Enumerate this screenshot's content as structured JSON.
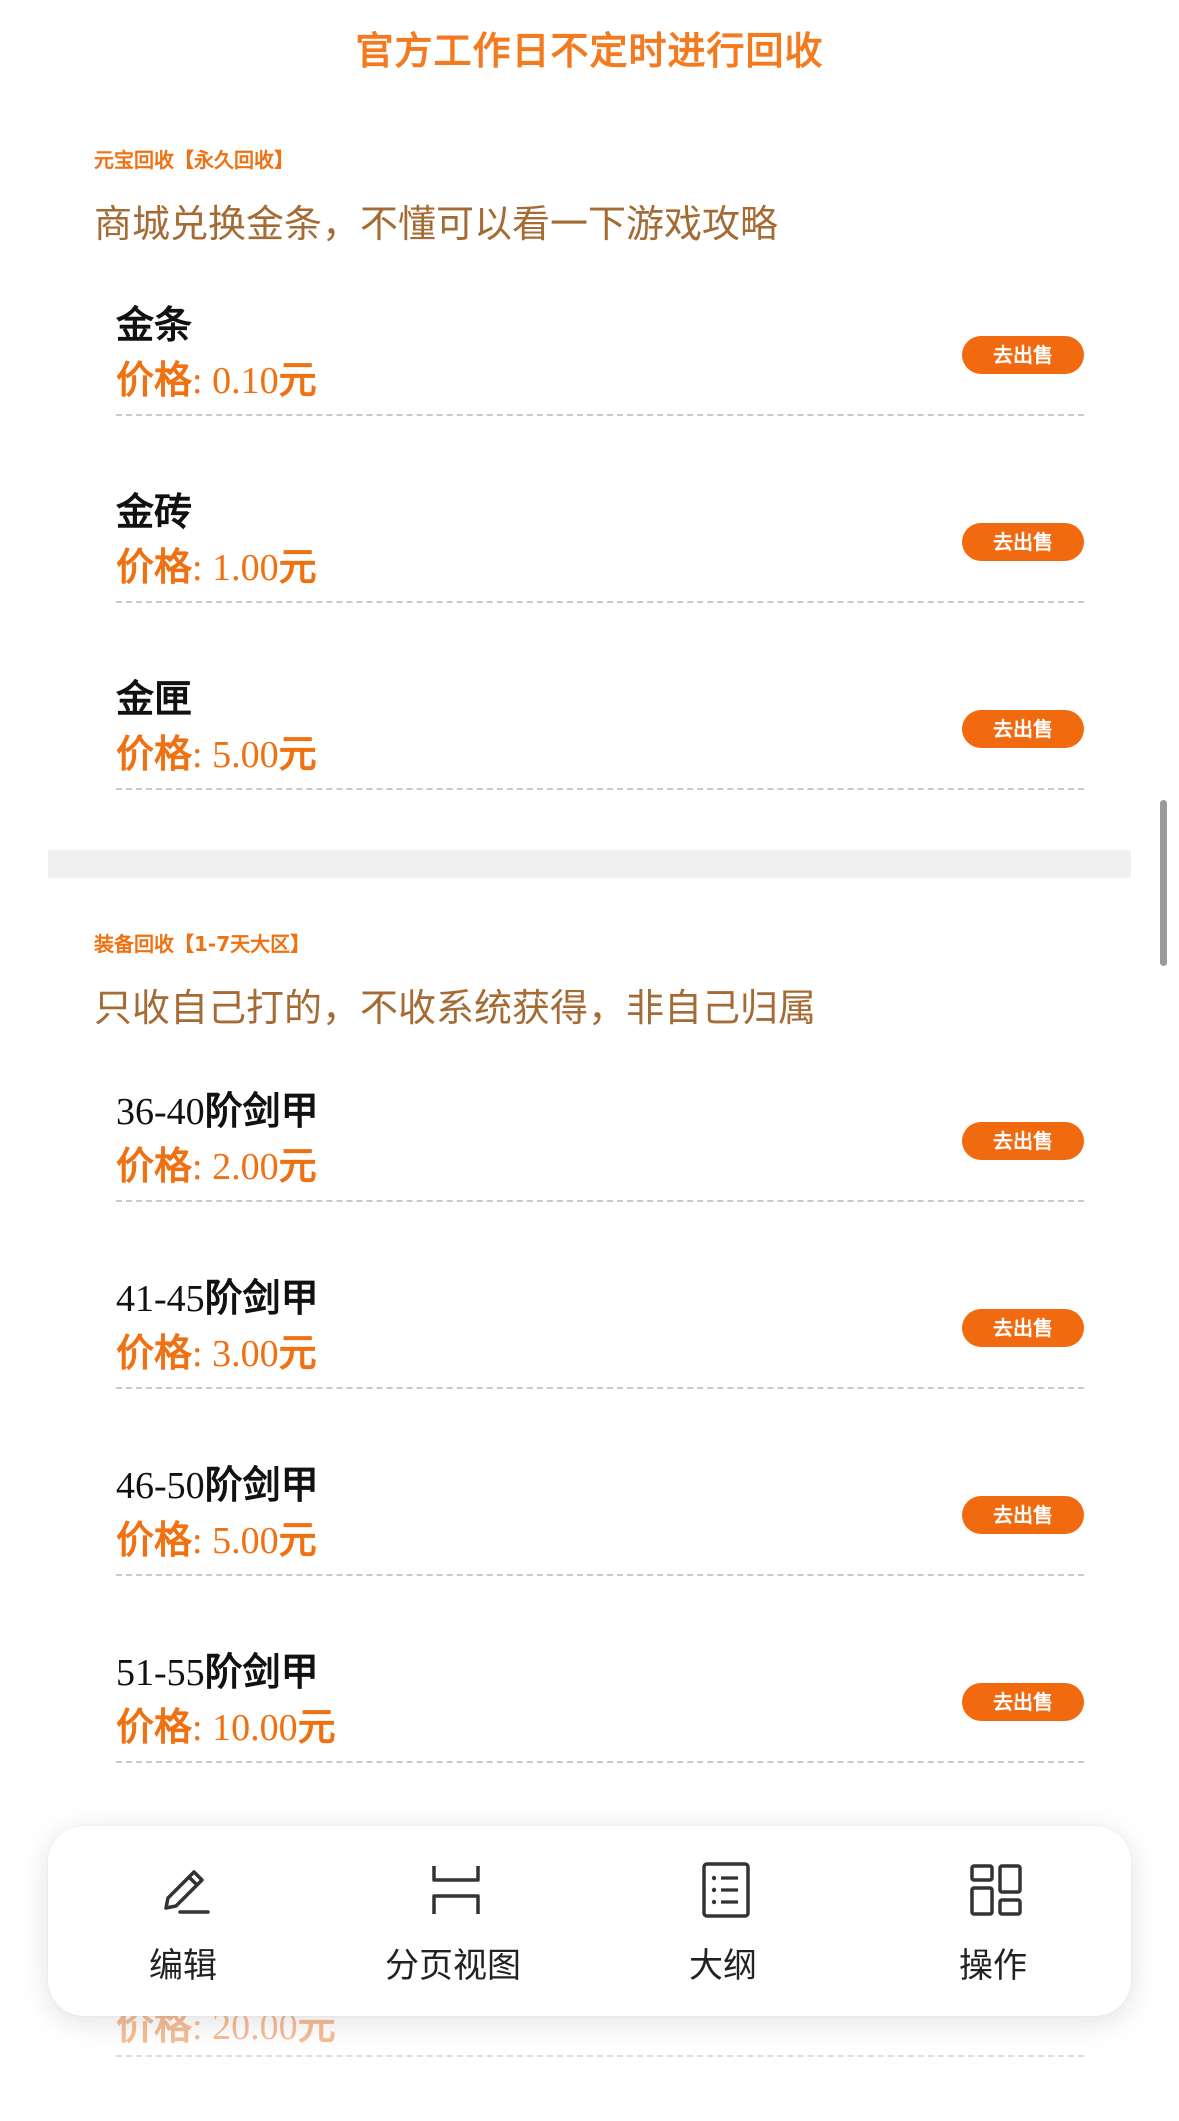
{
  "banner": "官方工作日不定时进行回收",
  "sections": [
    {
      "tag": "元宝回收【永久回收】",
      "desc": "商城兑换金条，不懂可以看一下游戏攻略",
      "items": [
        {
          "name": "金条",
          "price_label": "价格",
          "price_value": ": 0.10",
          "unit": "元",
          "button": "去出售"
        },
        {
          "name": "金砖",
          "price_label": "价格",
          "price_value": ": 1.00",
          "unit": "元",
          "button": "去出售"
        },
        {
          "name": "金匣",
          "price_label": "价格",
          "price_value": ": 5.00",
          "unit": "元",
          "button": "去出售"
        }
      ]
    },
    {
      "tag": "装备回收【1-7天大区】",
      "desc": "只收自己打的，不收系统获得，非自己归属",
      "items": [
        {
          "name_num": "36-40",
          "name": "阶剑甲",
          "price_label": "价格",
          "price_value": ": 2.00",
          "unit": "元",
          "button": "去出售"
        },
        {
          "name_num": "41-45",
          "name": "阶剑甲",
          "price_label": "价格",
          "price_value": ": 3.00",
          "unit": "元",
          "button": "去出售"
        },
        {
          "name_num": "46-50",
          "name": "阶剑甲",
          "price_label": "价格",
          "price_value": ": 5.00",
          "unit": "元",
          "button": "去出售"
        },
        {
          "name_num": "51-55",
          "name": "阶剑甲",
          "price_label": "价格",
          "price_value": ": 10.00",
          "unit": "元",
          "button": "去出售"
        }
      ]
    }
  ],
  "partial_item": {
    "price_label": "价格",
    "price_value": ": 20.00",
    "unit": "元"
  },
  "toolbar": [
    {
      "label": "编辑",
      "icon": "pencil-icon"
    },
    {
      "label": "分页视图",
      "icon": "page-view-icon"
    },
    {
      "label": "大纲",
      "icon": "outline-icon"
    },
    {
      "label": "操作",
      "icon": "grid-icon"
    }
  ],
  "colors": {
    "accent": "#f26a0f",
    "desc": "#a56b34",
    "banner": "#f47a1f"
  }
}
